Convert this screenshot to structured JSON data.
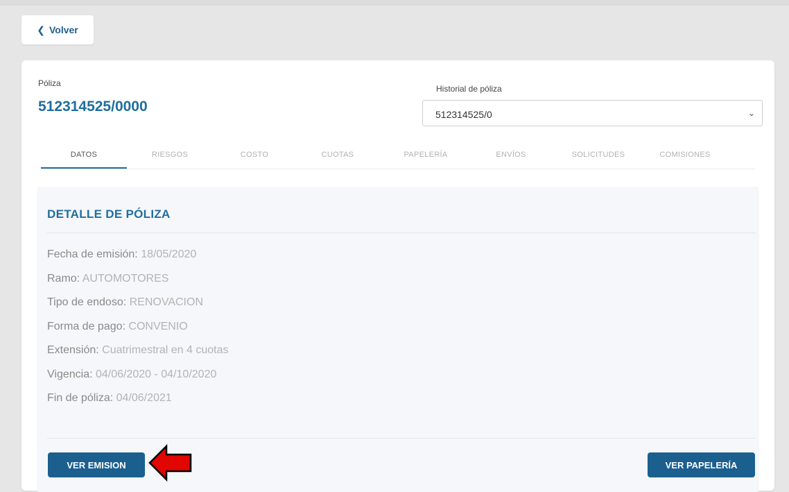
{
  "back": {
    "label": "Volver"
  },
  "policy": {
    "label": "Póliza",
    "number": "512314525/0000"
  },
  "history": {
    "label": "Historial de póliza",
    "selected": "512314525/0"
  },
  "tabs": [
    {
      "label": "DATOS",
      "active": true
    },
    {
      "label": "RIESGOS",
      "active": false
    },
    {
      "label": "COSTO",
      "active": false
    },
    {
      "label": "CUOTAS",
      "active": false
    },
    {
      "label": "PAPELERÍA",
      "active": false
    },
    {
      "label": "ENVÍOS",
      "active": false
    },
    {
      "label": "SOLICITUDES",
      "active": false
    },
    {
      "label": "COMISIONES",
      "active": false
    }
  ],
  "detail": {
    "title": "DETALLE DE PÓLIZA",
    "fields": [
      {
        "label": "Fecha de emisión:",
        "value": "18/05/2020"
      },
      {
        "label": "Ramo:",
        "value": "AUTOMOTORES"
      },
      {
        "label": "Tipo de endoso:",
        "value": "RENOVACION"
      },
      {
        "label": "Forma de pago:",
        "value": "CONVENIO"
      },
      {
        "label": "Extensión:",
        "value": "Cuatrimestral en 4 cuotas"
      },
      {
        "label": "Vigencia:",
        "value": "04/06/2020 - 04/10/2020"
      },
      {
        "label": "Fin de póliza:",
        "value": "04/06/2021"
      }
    ]
  },
  "actions": {
    "ver_emision": "VER EMISION",
    "ver_papeleria": "VER PAPELERÍA"
  },
  "colors": {
    "accent": "#1f6e9e",
    "button": "#1b5f8f",
    "arrow": "#e10600"
  },
  "icons": {
    "back": "chevron-left-icon",
    "dropdown": "chevron-down-icon",
    "annotation": "red-arrow-icon"
  }
}
